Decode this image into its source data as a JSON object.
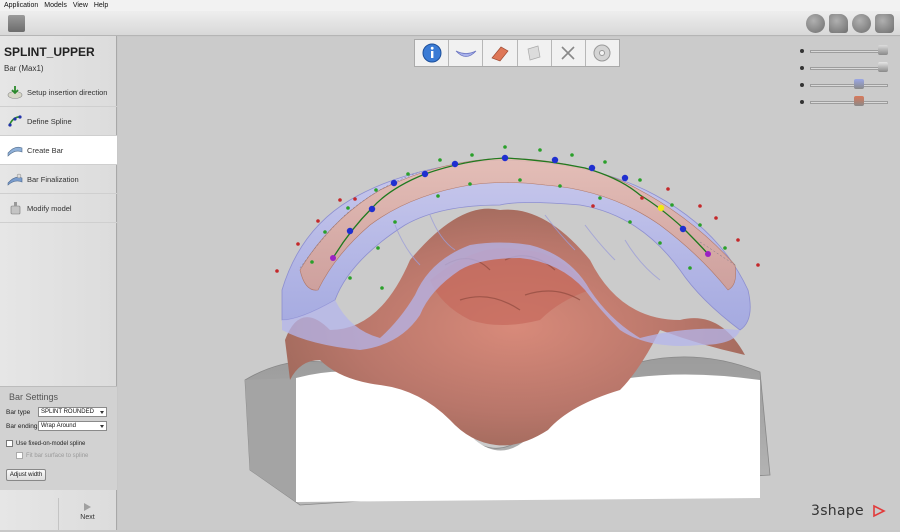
{
  "menu": {
    "items": [
      "Application",
      "Models",
      "View",
      "Help"
    ]
  },
  "toolbar": {
    "left_icon": "folder-icon",
    "right_icons": [
      "circle-icon",
      "shape-icon",
      "gear-icon",
      "window-icon"
    ]
  },
  "left_panel": {
    "title": "SPLINT_UPPER",
    "subtitle": "Bar (Max1)",
    "steps": [
      {
        "label": "Setup insertion direction",
        "icon": "insertion-direction-icon",
        "active": false
      },
      {
        "label": "Define Spline",
        "icon": "spline-icon",
        "active": false
      },
      {
        "label": "Create Bar",
        "icon": "create-bar-icon",
        "active": true
      },
      {
        "label": "Bar Finalization",
        "icon": "bar-finalization-icon",
        "active": false
      },
      {
        "label": "Modify model",
        "icon": "modify-model-icon",
        "active": false
      }
    ],
    "settings": {
      "title": "Bar Settings",
      "bar_type_label": "Bar type",
      "bar_type_value": "SPLINT ROUNDED",
      "bar_ending_label": "Bar ending",
      "bar_ending_value": "Wrap Around",
      "fixed_spline_label": "Use fixed-on-model spline",
      "fit_surface_label": "Fit bar surface to spline",
      "adjust_width_label": "Adjust width"
    },
    "next_label": "Next"
  },
  "viewport": {
    "step_icons": [
      "info-icon",
      "splint-icon",
      "bar-icon",
      "model-icon",
      "tools-icon",
      "disc-icon"
    ],
    "visibility_sliders": [
      {
        "name": "model-visibility-slider",
        "value": 1.0,
        "color": "#dcdcdc"
      },
      {
        "name": "antagonist-visibility-slider",
        "value": 1.0,
        "color": "#e6e6e6"
      },
      {
        "name": "splint-visibility-slider",
        "value": 0.65,
        "color": "#9aa6e6"
      },
      {
        "name": "bar-visibility-slider",
        "value": 0.65,
        "color": "#d8785a"
      }
    ],
    "brand": "3shape"
  }
}
